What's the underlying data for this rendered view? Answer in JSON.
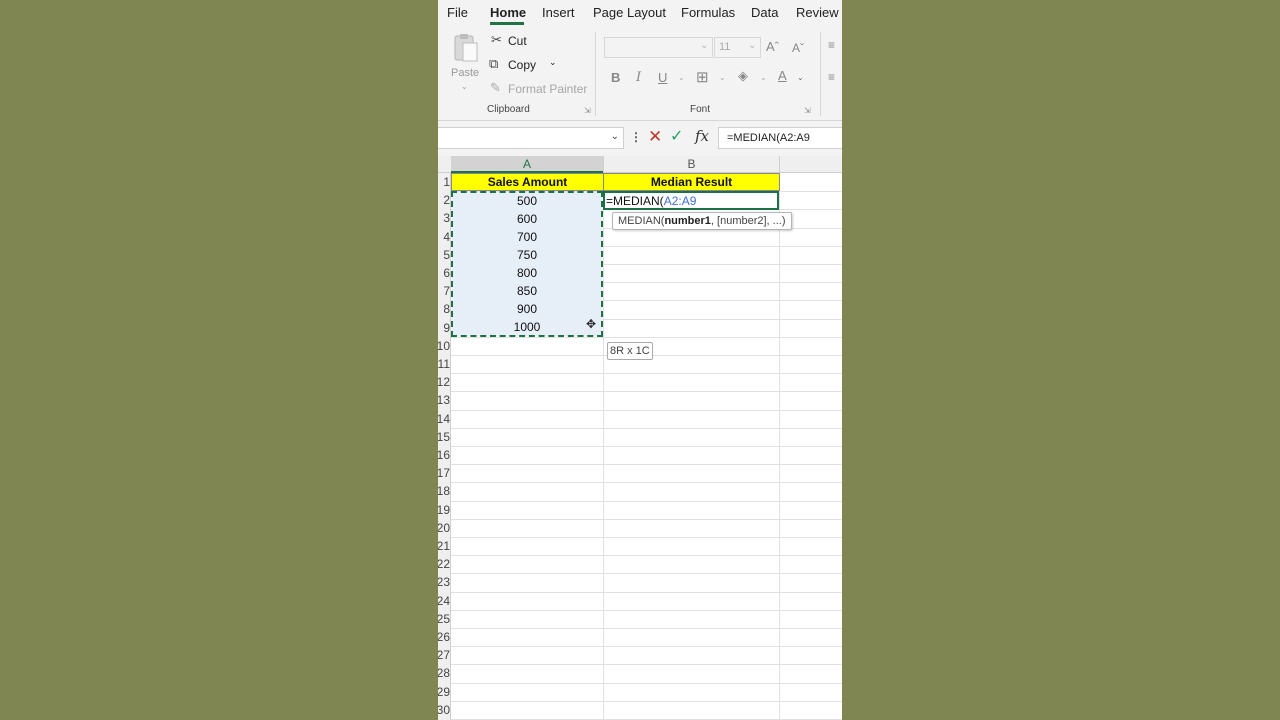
{
  "menu": {
    "tabs": [
      "File",
      "Home",
      "Insert",
      "Page Layout",
      "Formulas",
      "Data",
      "Review"
    ],
    "active": "Home"
  },
  "ribbon": {
    "clipboard": {
      "paste_label": "Paste",
      "cut_label": "Cut",
      "copy_label": "Copy",
      "format_painter_label": "Format Painter",
      "group_label": "Clipboard"
    },
    "font": {
      "font_name": "",
      "font_size": "11",
      "bold": "B",
      "italic": "I",
      "underline": "U",
      "group_label": "Font"
    }
  },
  "formula_bar": {
    "name_box": "",
    "fx_label": "fx",
    "formula": "=MEDIAN(A2:A9"
  },
  "grid": {
    "columns": [
      "A",
      "B"
    ],
    "row_labels": [
      "1",
      "2",
      "3",
      "4",
      "5",
      "6",
      "7",
      "8",
      "9",
      "10",
      "11",
      "12",
      "13",
      "14",
      "15",
      "16",
      "17",
      "18",
      "19",
      "20",
      "21",
      "22",
      "23",
      "24",
      "25",
      "26",
      "27",
      "28",
      "29",
      "30"
    ],
    "header_a": "Sales Amount",
    "header_b": "Median Result",
    "values": [
      "500",
      "600",
      "700",
      "750",
      "800",
      "850",
      "900",
      "1000"
    ],
    "editing_prefix": "=MEDIAN(",
    "editing_ref": "A2:A9",
    "tooltip_fn": "MEDIAN(",
    "tooltip_arg1": "number1",
    "tooltip_rest": ", [number2], ...)",
    "selection_size": "8R x 1C"
  },
  "colors": {
    "background": "#808652",
    "header_fill": "#ffff00",
    "selection_fill": "#e6eef8",
    "accent": "#217346"
  }
}
